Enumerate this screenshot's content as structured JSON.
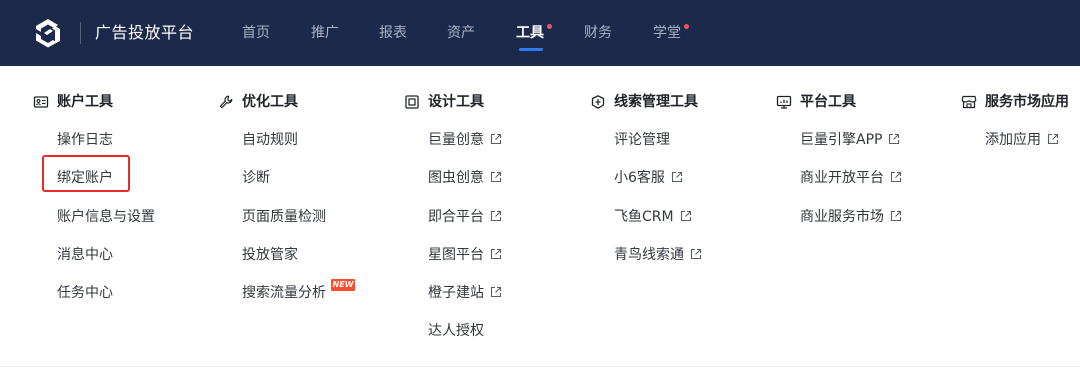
{
  "header": {
    "brand": "广告投放平台",
    "nav": [
      {
        "label": "首页",
        "active": false,
        "dot": false
      },
      {
        "label": "推广",
        "active": false,
        "dot": false
      },
      {
        "label": "报表",
        "active": false,
        "dot": false
      },
      {
        "label": "资产",
        "active": false,
        "dot": false
      },
      {
        "label": "工具",
        "active": true,
        "dot": true
      },
      {
        "label": "财务",
        "active": false,
        "dot": false
      },
      {
        "label": "学堂",
        "active": false,
        "dot": true
      }
    ]
  },
  "columns": [
    {
      "title": "账户工具",
      "icon": "id-card-icon",
      "items": [
        {
          "label": "操作日志"
        },
        {
          "label": "绑定账户",
          "highlighted": true
        },
        {
          "label": "账户信息与设置"
        },
        {
          "label": "消息中心"
        },
        {
          "label": "任务中心"
        }
      ]
    },
    {
      "title": "优化工具",
      "icon": "wrench-icon",
      "items": [
        {
          "label": "自动规则"
        },
        {
          "label": "诊断"
        },
        {
          "label": "页面质量检测"
        },
        {
          "label": "投放管家"
        },
        {
          "label": "搜索流量分析",
          "badge": "NEW"
        }
      ]
    },
    {
      "title": "设计工具",
      "icon": "design-icon",
      "items": [
        {
          "label": "巨量创意",
          "external": true
        },
        {
          "label": "图虫创意",
          "external": true
        },
        {
          "label": "即合平台",
          "external": true
        },
        {
          "label": "星图平台",
          "external": true
        },
        {
          "label": "橙子建站",
          "external": true
        },
        {
          "label": "达人授权"
        }
      ]
    },
    {
      "title": "线索管理工具",
      "icon": "shield-icon",
      "items": [
        {
          "label": "评论管理"
        },
        {
          "label": "小6客服",
          "external": true
        },
        {
          "label": "飞鱼CRM",
          "external": true
        },
        {
          "label": "青鸟线索通",
          "external": true
        }
      ]
    },
    {
      "title": "平台工具",
      "icon": "monitor-icon",
      "items": [
        {
          "label": "巨量引擎APP",
          "external": true
        },
        {
          "label": "商业开放平台",
          "external": true
        },
        {
          "label": "商业服务市场",
          "external": true
        }
      ]
    },
    {
      "title": "服务市场应用",
      "icon": "store-icon",
      "items": [
        {
          "label": "添加应用",
          "external": true
        }
      ]
    }
  ],
  "colors": {
    "topbar": "#1b2a4a",
    "nav_active_underline": "#2f7bff",
    "nav_dot": "#f0506e",
    "highlight_border": "#e62b2b",
    "new_badge": "#ff4d2e"
  }
}
